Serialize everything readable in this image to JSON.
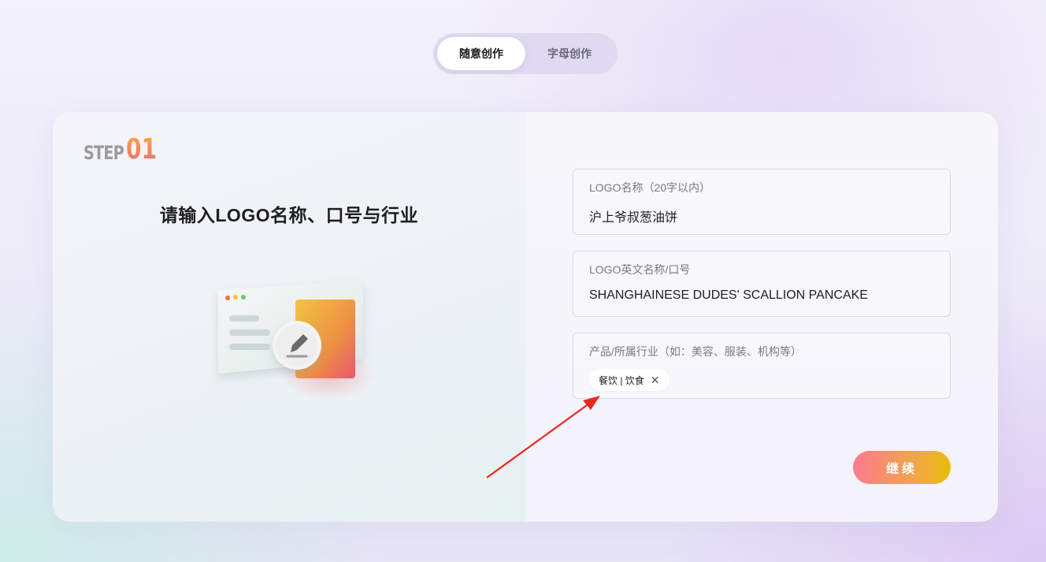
{
  "mode_toggle": {
    "tabs": [
      {
        "label": "随意创作",
        "active": true
      },
      {
        "label": "字母创作",
        "active": false
      }
    ]
  },
  "step": {
    "word": "STEP",
    "number": "01"
  },
  "left_panel": {
    "title": "请输入LOGO名称、口号与行业"
  },
  "form": {
    "name_field": {
      "label": "LOGO名称（20字以内）",
      "value": "沪上爷叔葱油饼"
    },
    "slogan_field": {
      "label": "LOGO英文名称/口号",
      "value": "SHANGHAINESE DUDES' SCALLION PANCAKE"
    },
    "industry_field": {
      "label": "产品/所属行业（如：美容、服装、机构等）",
      "tag": "餐饮 | 饮食",
      "tag_close": "✕"
    },
    "continue_label": "继续"
  },
  "colors": {
    "accent_start": "#fc7a8e",
    "accent_end": "#e9bd0a",
    "arrow": "#e8281e"
  },
  "icons": [
    "pencil-icon",
    "close-icon"
  ]
}
